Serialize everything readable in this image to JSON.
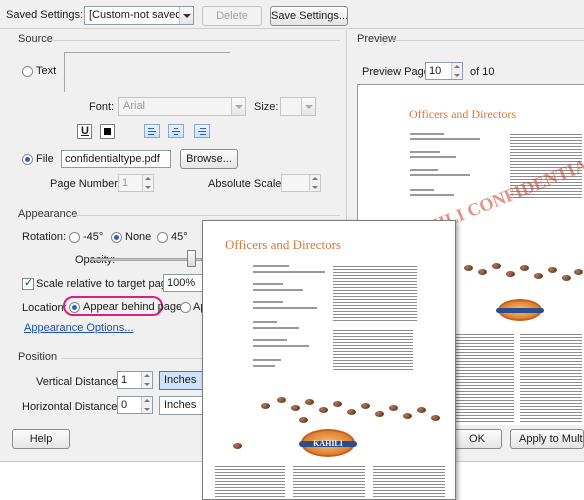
{
  "top": {
    "saved_settings_label": "Saved Settings:",
    "saved_settings_value": "[Custom-not saved]",
    "delete_label": "Delete",
    "save_settings_label": "Save Settings..."
  },
  "source": {
    "title": "Source",
    "text_label": "Text",
    "font_label": "Font:",
    "font_value": "Arial",
    "size_label": "Size:",
    "underline_label": "U",
    "file_label": "File",
    "file_value": "confidentialtype.pdf",
    "browse_label": "Browse...",
    "page_number_label": "Page Number:",
    "page_number_value": "1",
    "absolute_scale_label": "Absolute Scale:"
  },
  "appearance": {
    "title": "Appearance",
    "rotation_label": "Rotation:",
    "rot_neg45": "-45°",
    "rot_none": "None",
    "rot_45": "45°",
    "opacity_label": "Opacity:",
    "opacity_value": 0.9,
    "scale_label": "Scale relative to target page",
    "scale_value": "100%",
    "location_label": "Location:",
    "behind_label": "Appear behind page",
    "on_top_label": "App",
    "options_link": "Appearance Options..."
  },
  "position": {
    "title": "Position",
    "vertical_label": "Vertical Distance:",
    "vertical_value": "1",
    "vertical_unit": "Inches",
    "horizontal_label": "Horizontal Distance:",
    "horizontal_value": "0",
    "horizontal_unit": "Inches"
  },
  "preview": {
    "title": "Preview",
    "page_label": "Preview Page",
    "page_value": "10",
    "of_label": "of 10",
    "doc_title": "Officers and Directors",
    "logo_text": "KAHILI",
    "watermark_text": "KAHILI CONFIDENTIAL"
  },
  "buttons": {
    "help": "Help",
    "ok": "OK",
    "apply_multiple": "Apply to Multiple"
  },
  "colors": {
    "accent": "#d8227a",
    "title_orange": "#d47a42",
    "dialog_bg": "#f0f0f0"
  }
}
